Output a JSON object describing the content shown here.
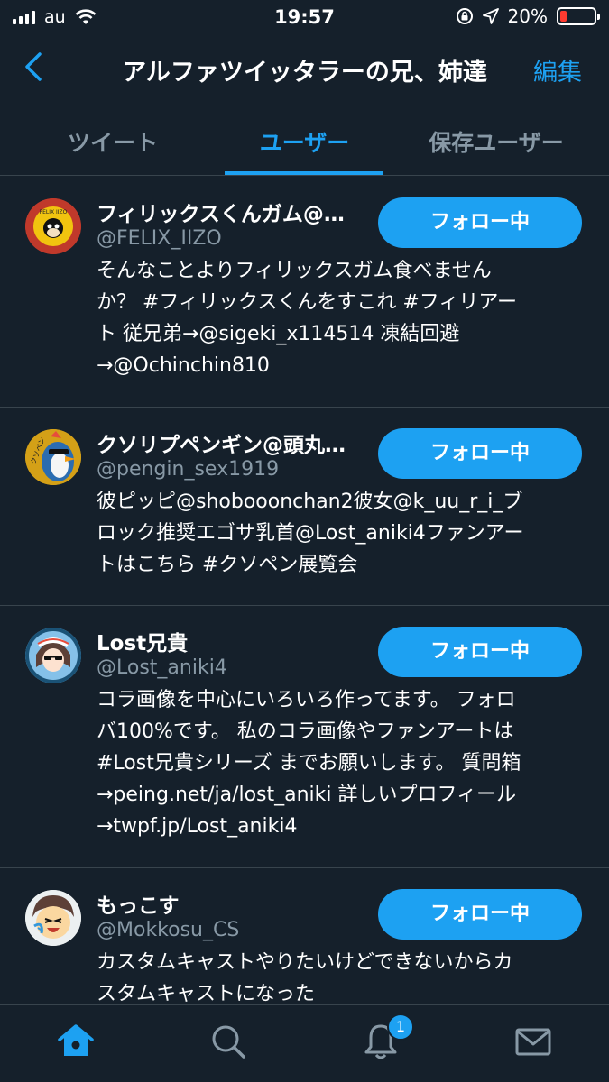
{
  "status_bar": {
    "carrier": "au",
    "time": "19:57",
    "battery": "20%",
    "battery_level": 0.2
  },
  "header": {
    "title": "アルファツイッタラーの兄、姉達",
    "edit_label": "編集"
  },
  "tabs": [
    {
      "label": "ツイート",
      "active": false
    },
    {
      "label": "ユーザー",
      "active": true
    },
    {
      "label": "保存ユーザー",
      "active": false
    }
  ],
  "users": [
    {
      "name": "フィリックスくんガム@…",
      "handle": "@FELIX_IIZO",
      "follow_label": "フォロー中",
      "bio": "そんなことよりフィリックスガム食べません\nか？ #フィリックスくんをすこれ #フィリアー\nト 従兄弟→@sigeki_x114514 凍結回避\n→@Ochinchin810",
      "avatar_text": "FELIX IIZO"
    },
    {
      "name": "クソリプペンギン@頭丸…",
      "handle": "@pengin_sex1919",
      "follow_label": "フォロー中",
      "bio": "彼ピッピ@shobooonchan2彼女@k_uu_r_i_ブ\nロック推奨エゴサ乳首@Lost_aniki4ファンアー\nトはこちら #クソペン展覧会",
      "avatar_text": "クソペン"
    },
    {
      "name": "Lost兄貴",
      "handle": "@Lost_aniki4",
      "follow_label": "フォロー中",
      "bio": "コラ画像を中心にいろいろ作ってます。 フォロ\nバ100%です。 私のコラ画像やファンアートは\n#Lost兄貴シリーズ までお願いします。 質問箱\n→peing.net/ja/lost_aniki 詳しいプロフィール\n→twpf.jp/Lost_aniki4"
    },
    {
      "name": "もっこす",
      "handle": "@Mokkosu_CS",
      "follow_label": "フォロー中",
      "bio": "カスタムキャストやりたいけどできないからカ\nスタムキャストになった"
    }
  ],
  "tabbar": {
    "notification_count": "1"
  },
  "colors": {
    "background": "#15202b",
    "accent": "#1da1f2",
    "secondary_text": "#8899a6",
    "divider": "#38444d",
    "battery_low": "#ff3b30"
  }
}
